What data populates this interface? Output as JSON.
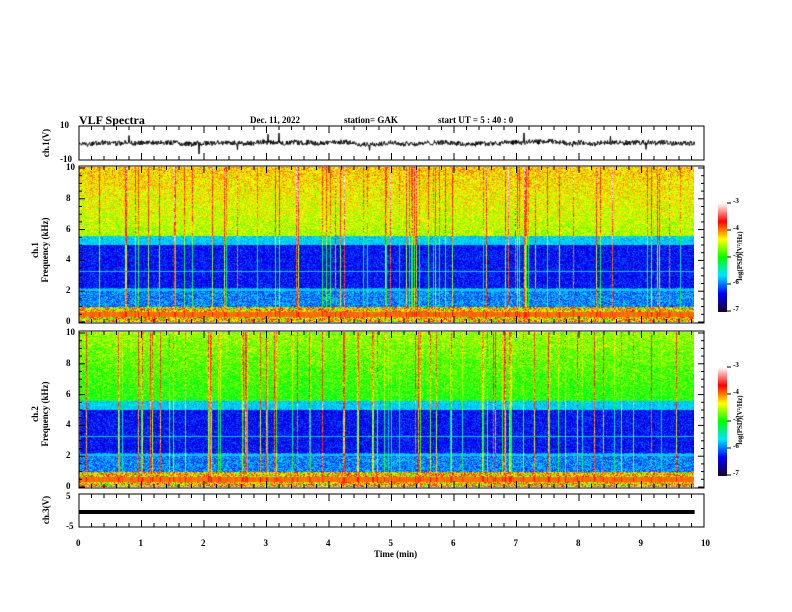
{
  "chart_data": [
    {
      "type": "line",
      "panel": "ch1",
      "ylabel": "ch.1(V)",
      "ylim": [
        -10,
        10
      ],
      "yticks": [
        "10",
        "-10"
      ],
      "xlim": [
        0,
        10
      ],
      "baseline_v": 0,
      "noise_amplitude_v": 1.5
    },
    {
      "type": "heatmap",
      "panel": "ch1-spectrogram",
      "ylabel": "ch.1 Frequency (kHz)",
      "ylim": [
        0,
        10
      ],
      "yticks": [
        "0",
        "2",
        "4",
        "6",
        "8",
        "10"
      ],
      "xlim": [
        0,
        10
      ],
      "data_end_min": 9.85,
      "colorbar": {
        "label": "log(PSD)(V²/Hz)",
        "range": [
          -7,
          -3
        ],
        "ticks": [
          "-3",
          "-4",
          "-5",
          "-6",
          "-7"
        ]
      }
    },
    {
      "type": "heatmap",
      "panel": "ch2-spectrogram",
      "ylabel": "ch.2 Frequency (kHz)",
      "ylim": [
        0,
        10
      ],
      "yticks": [
        "0",
        "2",
        "4",
        "6",
        "8",
        "10"
      ],
      "xlim": [
        0,
        10
      ],
      "data_end_min": 9.85,
      "colorbar": {
        "label": "log(PSD)(V²/Hz)",
        "range": [
          -7,
          -3
        ],
        "ticks": [
          "-3",
          "-4",
          "-5",
          "-6",
          "-7"
        ]
      }
    },
    {
      "type": "line",
      "panel": "ch3",
      "ylabel": "ch.3(V)",
      "ylim": [
        -5,
        5
      ],
      "yticks": [
        "5",
        "-5"
      ],
      "xlim": [
        0,
        10
      ],
      "values_v": 0,
      "xlabel": "Time (min)",
      "xticks": [
        "0",
        "1",
        "2",
        "3",
        "4",
        "5",
        "6",
        "7",
        "8",
        "9",
        "10"
      ]
    }
  ],
  "header": {
    "title": "VLF Spectra",
    "date": "Dec. 11, 2022",
    "station": "station= GAK",
    "start": "start  UT =   5  : 40 : 0"
  },
  "labels": {
    "ch1": "ch.1(V)",
    "ch1spec_a": "ch.1",
    "ch1spec_b": "Frequency  (kHz)",
    "ch2spec_a": "ch.2",
    "ch2spec_b": "Frequency  (kHz)",
    "ch3": "ch.3(V)",
    "xlabel": "Time  (min)",
    "cbar": "log(PSD)(V²/Hz)"
  },
  "colors": {
    "colormap": [
      "#1a0033",
      "#0000ff",
      "#00e5ff",
      "#00ff00",
      "#ffff00",
      "#ff0000",
      "#ffffff"
    ],
    "trace": "#000000"
  }
}
